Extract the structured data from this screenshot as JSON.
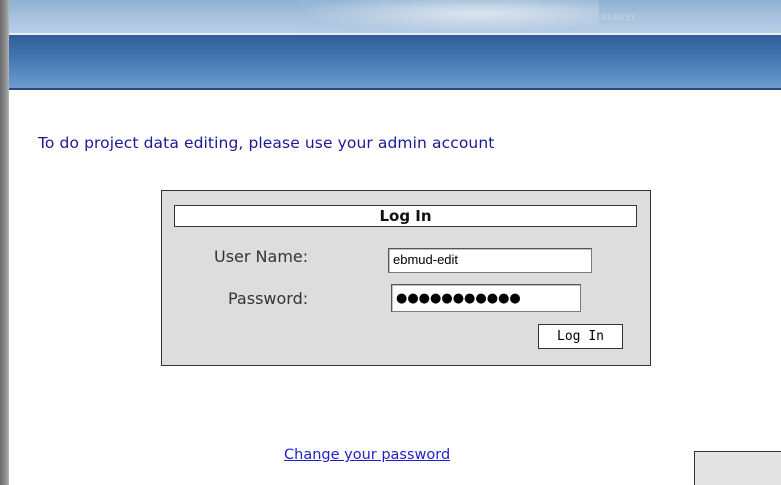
{
  "banner": {
    "map_text": "NEARBY"
  },
  "instruction": "To do project data editing, please use your admin account",
  "login": {
    "title": "Log In",
    "username_label": "User Name:",
    "username_value": "ebmud-edit",
    "password_label": "Password:",
    "password_value": "●●●●●●●●●●●",
    "button_label": "Log In"
  },
  "links": {
    "change_password": "Change your password"
  },
  "colors": {
    "header_blue": "#3f72ad",
    "instruction_text": "#1a1a99",
    "link": "#1f1fcc",
    "login_panel": "#dddddd"
  }
}
